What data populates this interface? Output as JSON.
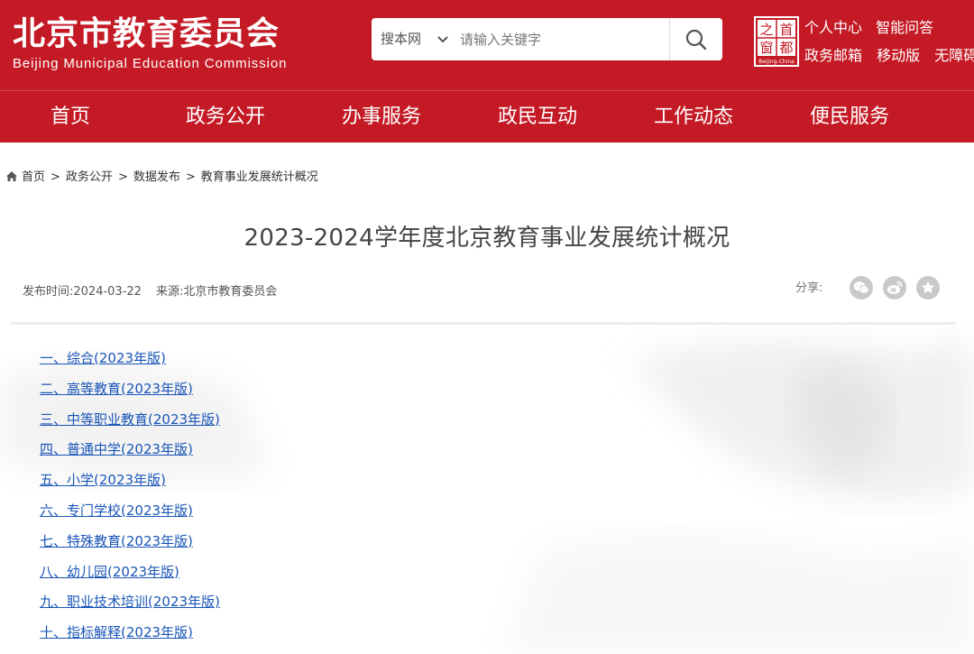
{
  "header": {
    "logo_cn": "北京市教育委员会",
    "logo_en": "Beijing Municipal Education Commission",
    "search": {
      "scope": "搜本网",
      "placeholder": "请输入关键字"
    },
    "seal": {
      "chars": [
        "之",
        "首",
        "窗",
        "都"
      ],
      "caption": "Beijing-China"
    },
    "top_links": [
      [
        "个人中心",
        "智能问答"
      ],
      [
        "政务邮箱",
        "移动版",
        "无障碍"
      ]
    ],
    "nav": [
      "首页",
      "政务公开",
      "办事服务",
      "政民互动",
      "工作动态",
      "便民服务"
    ],
    "colors": {
      "brand_red": "#c41a25",
      "link_blue": "#1a56b8"
    }
  },
  "breadcrumb": [
    "首页",
    "政务公开",
    "数据发布",
    "教育事业发展统计概况"
  ],
  "article": {
    "title": "2023-2024学年度北京教育事业发展统计概况",
    "publish_label": "发布时间:2024-03-22",
    "source_label": "来源:北京市教育委员会",
    "share_label": "分享:",
    "share_icons": [
      "wechat-icon",
      "weibo-icon",
      "favorite-star-icon"
    ]
  },
  "links": [
    "一、综合(2023年版)",
    "二、高等教育(2023年版)",
    "三、中等职业教育(2023年版)",
    "四、普通中学(2023年版)",
    "五、小学(2023年版)",
    "六、专门学校(2023年版)",
    "七、特殊教育(2023年版)",
    "八、幼儿园(2023年版)",
    "九、职业技术培训(2023年版)",
    "十、指标解释(2023年版)"
  ]
}
